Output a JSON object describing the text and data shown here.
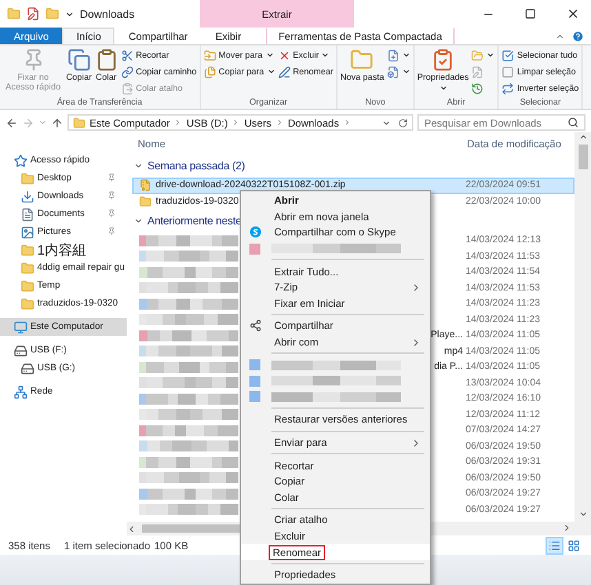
{
  "window": {
    "title": "Downloads",
    "context_header": "Extrair"
  },
  "ribbon_tabs": [
    {
      "label": "Arquivo",
      "kind": "file",
      "selected": false
    },
    {
      "label": "Início",
      "kind": "tab",
      "selected": true
    },
    {
      "label": "Compartilhar",
      "kind": "tab",
      "selected": false
    },
    {
      "label": "Exibir",
      "kind": "tab",
      "selected": false
    },
    {
      "label": "Ferramentas de Pasta Compactada",
      "kind": "context",
      "selected": false
    }
  ],
  "ribbon_groups": [
    {
      "label": "Área de Transferência",
      "buttons": [
        {
          "label": "Fixar no Acesso rápido",
          "kind": "large",
          "disabled": true,
          "dropdown": false
        },
        {
          "label": "Copiar",
          "kind": "large",
          "disabled": false,
          "dropdown": false
        },
        {
          "label": "Colar",
          "kind": "large",
          "disabled": false,
          "dropdown": false
        },
        {
          "label": "Recortar",
          "kind": "small",
          "disabled": false,
          "dropdown": false
        },
        {
          "label": "Copiar caminho",
          "kind": "small",
          "disabled": false,
          "dropdown": false
        },
        {
          "label": "Colar atalho",
          "kind": "small",
          "disabled": true,
          "dropdown": false
        }
      ]
    },
    {
      "label": "Organizar",
      "buttons": [
        {
          "label": "Mover para",
          "kind": "small",
          "disabled": false,
          "dropdown": true
        },
        {
          "label": "Copiar para",
          "kind": "small",
          "disabled": false,
          "dropdown": true
        },
        {
          "label": "Excluir",
          "kind": "small",
          "disabled": false,
          "dropdown": true
        },
        {
          "label": "Renomear",
          "kind": "small",
          "disabled": false,
          "dropdown": false
        }
      ]
    },
    {
      "label": "Novo",
      "buttons": [
        {
          "label": "Nova pasta",
          "kind": "large",
          "disabled": false,
          "dropdown": false
        },
        {
          "kind": "small",
          "disabled": false,
          "dropdown": true
        },
        {
          "kind": "small",
          "disabled": false,
          "dropdown": true
        }
      ]
    },
    {
      "label": "Abrir",
      "buttons": [
        {
          "label": "Propriedades",
          "kind": "large",
          "disabled": false,
          "dropdown": true
        },
        {
          "kind": "small",
          "disabled": false,
          "dropdown": true
        },
        {
          "kind": "small",
          "disabled": true,
          "dropdown": false
        },
        {
          "kind": "small",
          "disabled": false,
          "dropdown": false
        }
      ]
    },
    {
      "label": "Selecionar",
      "buttons": [
        {
          "label": "Selecionar tudo",
          "kind": "small",
          "disabled": false,
          "dropdown": false
        },
        {
          "label": "Limpar seleção",
          "kind": "small",
          "disabled": false,
          "dropdown": false
        },
        {
          "label": "Inverter seleção",
          "kind": "small",
          "disabled": false,
          "dropdown": false
        }
      ]
    }
  ],
  "address_bar": {
    "path": [
      "Este Computador",
      "USB (D:)",
      "Users",
      "Downloads"
    ],
    "search_placeholder": "Pesquisar em Downloads"
  },
  "sidebar": [
    {
      "label": "Acesso rápido",
      "kind": "quick_access",
      "pinned": false,
      "selected": false
    },
    {
      "label": "Desktop",
      "kind": "folder",
      "pinned": true,
      "selected": false
    },
    {
      "label": "Downloads",
      "kind": "downloads",
      "pinned": true,
      "selected": false
    },
    {
      "label": "Documents",
      "kind": "documents",
      "pinned": true,
      "selected": false
    },
    {
      "label": "Pictures",
      "kind": "pictures",
      "pinned": true,
      "selected": false
    },
    {
      "label": "1内容組",
      "kind": "folder",
      "pinned": false,
      "selected": false
    },
    {
      "label": "4ddig email repair gu",
      "kind": "folder",
      "pinned": false,
      "selected": false
    },
    {
      "label": "Temp",
      "kind": "folder",
      "pinned": false,
      "selected": false
    },
    {
      "label": "traduzidos-19-0320",
      "kind": "folder",
      "pinned": false,
      "selected": false
    },
    {
      "label": "Este Computador",
      "kind": "computer",
      "pinned": false,
      "selected": true
    },
    {
      "label": "USB (F:)",
      "kind": "drive",
      "pinned": false,
      "selected": false
    },
    {
      "label": "USB (G:)",
      "kind": "drive",
      "pinned": false,
      "selected": false
    },
    {
      "label": "Rede",
      "kind": "network",
      "pinned": false,
      "selected": false
    }
  ],
  "file_list": {
    "columns": [
      "Nome",
      "Data de modificação"
    ],
    "groups": [
      {
        "label": "Semana passada (2)",
        "rows": [
          {
            "name": "drive-download-20240322T015108Z-001.zip",
            "date": "22/03/2024 09:51",
            "kind": "zip",
            "selected": true
          },
          {
            "name": "traduzidos-19-0320",
            "date": "22/03/2024 10:00",
            "kind": "folder",
            "selected": false
          }
        ]
      },
      {
        "label": "Anteriormente neste",
        "rows": [
          {
            "date": "14/03/2024 12:13",
            "kind": "blurred",
            "selected": false
          },
          {
            "date": "14/03/2024 11:53",
            "kind": "blurred",
            "selected": false
          },
          {
            "date": "14/03/2024 11:54",
            "kind": "blurred",
            "selected": false
          },
          {
            "date": "14/03/2024 11:53",
            "kind": "blurred",
            "selected": false
          },
          {
            "date": "14/03/2024 11:23",
            "kind": "blurred",
            "selected": false
          },
          {
            "date": "14/03/2024 11:23",
            "kind": "blurred",
            "selected": false
          },
          {
            "name_tail": "Playe...",
            "date": "14/03/2024 11:05",
            "kind": "blurred",
            "selected": false
          },
          {
            "name_tail": "mp4",
            "date": "14/03/2024 11:05",
            "kind": "blurred",
            "selected": false
          },
          {
            "name_tail": "dia P...",
            "date": "14/03/2024 11:05",
            "kind": "blurred",
            "selected": false
          },
          {
            "date": "13/03/2024 10:04",
            "kind": "blurred",
            "selected": false
          },
          {
            "date": "12/03/2024 16:10",
            "kind": "blurred",
            "selected": false
          },
          {
            "date": "12/03/2024 11:12",
            "kind": "blurred",
            "selected": false
          },
          {
            "date": "07/03/2024 14:27",
            "kind": "blurred",
            "selected": false
          },
          {
            "date": "06/03/2024 19:50",
            "kind": "blurred",
            "selected": false
          },
          {
            "date": "06/03/2024 19:31",
            "kind": "blurred",
            "selected": false
          },
          {
            "date": "06/03/2024 19:50",
            "kind": "blurred",
            "selected": false
          },
          {
            "date": "06/03/2024 19:27",
            "kind": "blurred",
            "selected": false
          },
          {
            "date": "06/03/2024 19:27",
            "kind": "blurred",
            "selected": false
          }
        ]
      }
    ]
  },
  "status_bar": {
    "count": "358 itens",
    "selection": "1 item selecionado",
    "size": "100 KB"
  },
  "context_menu": [
    {
      "kind": "item",
      "label": "Abrir",
      "bold": true,
      "submenu": false,
      "selected": false
    },
    {
      "kind": "item",
      "label": "Abrir em nova janela",
      "bold": false,
      "submenu": false,
      "selected": false
    },
    {
      "kind": "skype",
      "label": "Compartilhar com o Skype",
      "bold": false,
      "submenu": false,
      "selected": false
    },
    {
      "kind": "blurred"
    },
    {
      "kind": "separator"
    },
    {
      "kind": "item",
      "label": "Extrair Tudo...",
      "bold": false,
      "submenu": false,
      "selected": false
    },
    {
      "kind": "item",
      "label": "7-Zip",
      "bold": false,
      "submenu": true,
      "selected": false
    },
    {
      "kind": "item",
      "label": "Fixar em Iniciar",
      "bold": false,
      "submenu": false,
      "selected": false
    },
    {
      "kind": "separator"
    },
    {
      "kind": "share",
      "label": "Compartilhar",
      "bold": false,
      "submenu": false,
      "selected": false
    },
    {
      "kind": "item",
      "label": "Abrir com",
      "bold": false,
      "submenu": true,
      "selected": false
    },
    {
      "kind": "separator"
    },
    {
      "kind": "blurred"
    },
    {
      "kind": "blurred"
    },
    {
      "kind": "blurred"
    },
    {
      "kind": "separator"
    },
    {
      "kind": "item",
      "label": "Restaurar versões anteriores",
      "bold": false,
      "submenu": false,
      "selected": false
    },
    {
      "kind": "separator"
    },
    {
      "kind": "item",
      "label": "Enviar para",
      "bold": false,
      "submenu": true,
      "selected": false
    },
    {
      "kind": "separator"
    },
    {
      "kind": "item",
      "label": "Recortar",
      "bold": false,
      "submenu": false,
      "selected": false
    },
    {
      "kind": "item",
      "label": "Copiar",
      "bold": false,
      "submenu": false,
      "selected": false
    },
    {
      "kind": "item",
      "label": "Colar",
      "bold": false,
      "submenu": false,
      "selected": false
    },
    {
      "kind": "separator"
    },
    {
      "kind": "item",
      "label": "Criar atalho",
      "bold": false,
      "submenu": false,
      "selected": false
    },
    {
      "kind": "item",
      "label": "Excluir",
      "bold": false,
      "submenu": false,
      "selected": false
    },
    {
      "kind": "item",
      "label": "Renomear",
      "bold": false,
      "submenu": false,
      "selected": true
    },
    {
      "kind": "separator"
    },
    {
      "kind": "item",
      "label": "Propriedades",
      "bold": false,
      "submenu": false,
      "selected": false
    }
  ]
}
